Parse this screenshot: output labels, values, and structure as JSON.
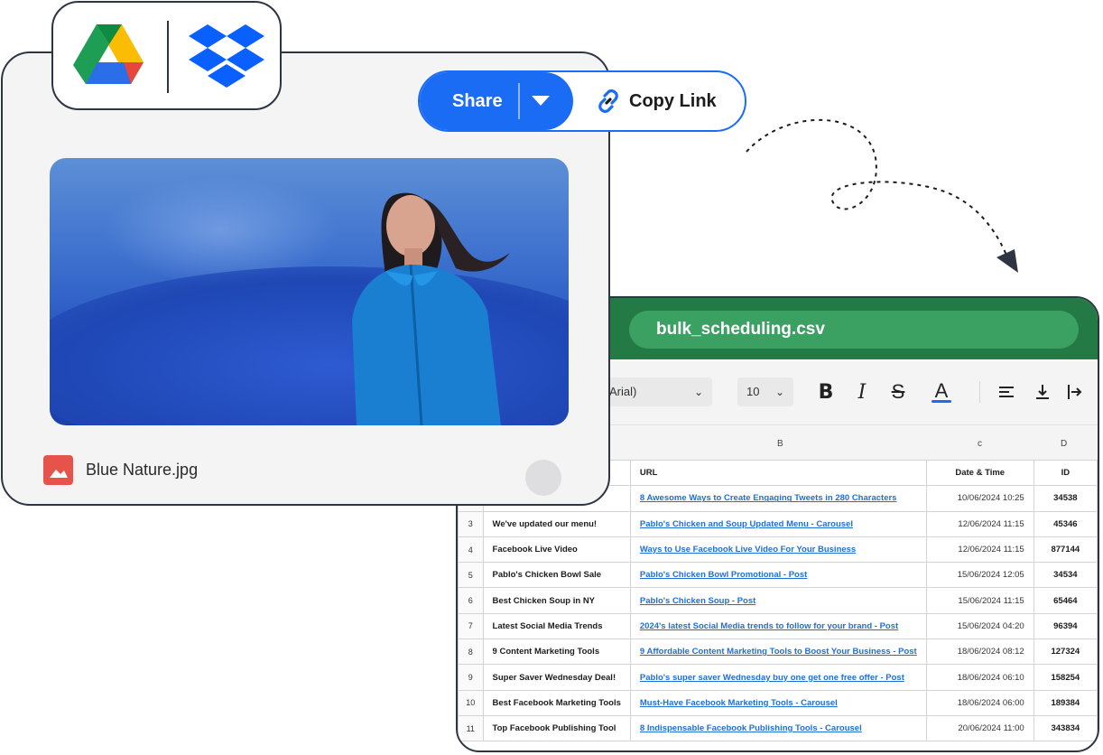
{
  "share": {
    "share_label": "Share",
    "copy_link_label": "Copy Link"
  },
  "file": {
    "name": "Blue Nature.jpg"
  },
  "sheet": {
    "filename": "bulk_scheduling.csv",
    "font": "Arial)",
    "font_size": "10",
    "column_letters": [
      "B",
      "c",
      "D"
    ],
    "headers": {
      "url": "URL",
      "date": "Date & Time",
      "id": "ID"
    },
    "rows": [
      {
        "num": "",
        "title": "",
        "url": "8 Awesome Ways to Create Engaging Tweets in 280 Characters",
        "date": "10/06/2024  10:25",
        "id": "34538"
      },
      {
        "num": "3",
        "title": "We've updated our menu!",
        "url": "Pablo's Chicken and Soup Updated Menu - Carousel",
        "date": "12/06/2024  11:15",
        "id": "45346"
      },
      {
        "num": "4",
        "title": "Facebook Live Video",
        "url": "Ways to Use Facebook Live Video For Your Business",
        "date": "12/06/2024  11:15",
        "id": "877144"
      },
      {
        "num": "5",
        "title": "Pablo's Chicken Bowl Sale",
        "url": "Pablo's Chicken Bowl Promotional - Post",
        "date": "15/06/2024  12:05",
        "id": "34534"
      },
      {
        "num": "6",
        "title": "Best Chicken Soup in NY",
        "url": "Pablo's Chicken Soup - Post",
        "date": "15/06/2024  11:15",
        "id": "65464"
      },
      {
        "num": "7",
        "title": "Latest Social Media Trends",
        "url": "2024's latest Social Media trends to follow for your brand - Post",
        "date": "15/06/2024  04:20",
        "id": "96394"
      },
      {
        "num": "8",
        "title": "9 Content Marketing Tools",
        "url": "9 Affordable Content Marketing Tools to Boost Your Business - Post",
        "date": "18/06/2024  08:12",
        "id": "127324"
      },
      {
        "num": "9",
        "title": "Super Saver Wednesday Deal!",
        "url": "Pablo's super saver Wednesday buy one get one free offer - Post",
        "date": "18/06/2024  06:10",
        "id": "158254"
      },
      {
        "num": "10",
        "title": "Best Facebook Marketing Tools",
        "url": "Must-Have Facebook Marketing Tools - Carousel",
        "date": "18/06/2024  06:00",
        "id": "189384"
      },
      {
        "num": "11",
        "title": "Top Facebook Publishing Tool",
        "url": "8 Indispensable Facebook Publishing Tools - Carousel",
        "date": "20/06/2024  11:00",
        "id": "343834"
      }
    ]
  },
  "icons": {
    "logos": [
      "google-drive-icon",
      "dropbox-icon"
    ],
    "toolbar": [
      "bold-icon",
      "italic-icon",
      "strikethrough-icon",
      "text-color-icon",
      "align-left-icon",
      "vertical-align-bottom-icon",
      "text-wrap-icon"
    ],
    "file": "image-file-icon",
    "link": "link-icon"
  },
  "colors": {
    "accent": "#1a6cf5",
    "sheet_header": "#237a45",
    "sheet_pill": "#3aa162",
    "link": "#1f6fd6",
    "file_icon": "#e5534b"
  }
}
